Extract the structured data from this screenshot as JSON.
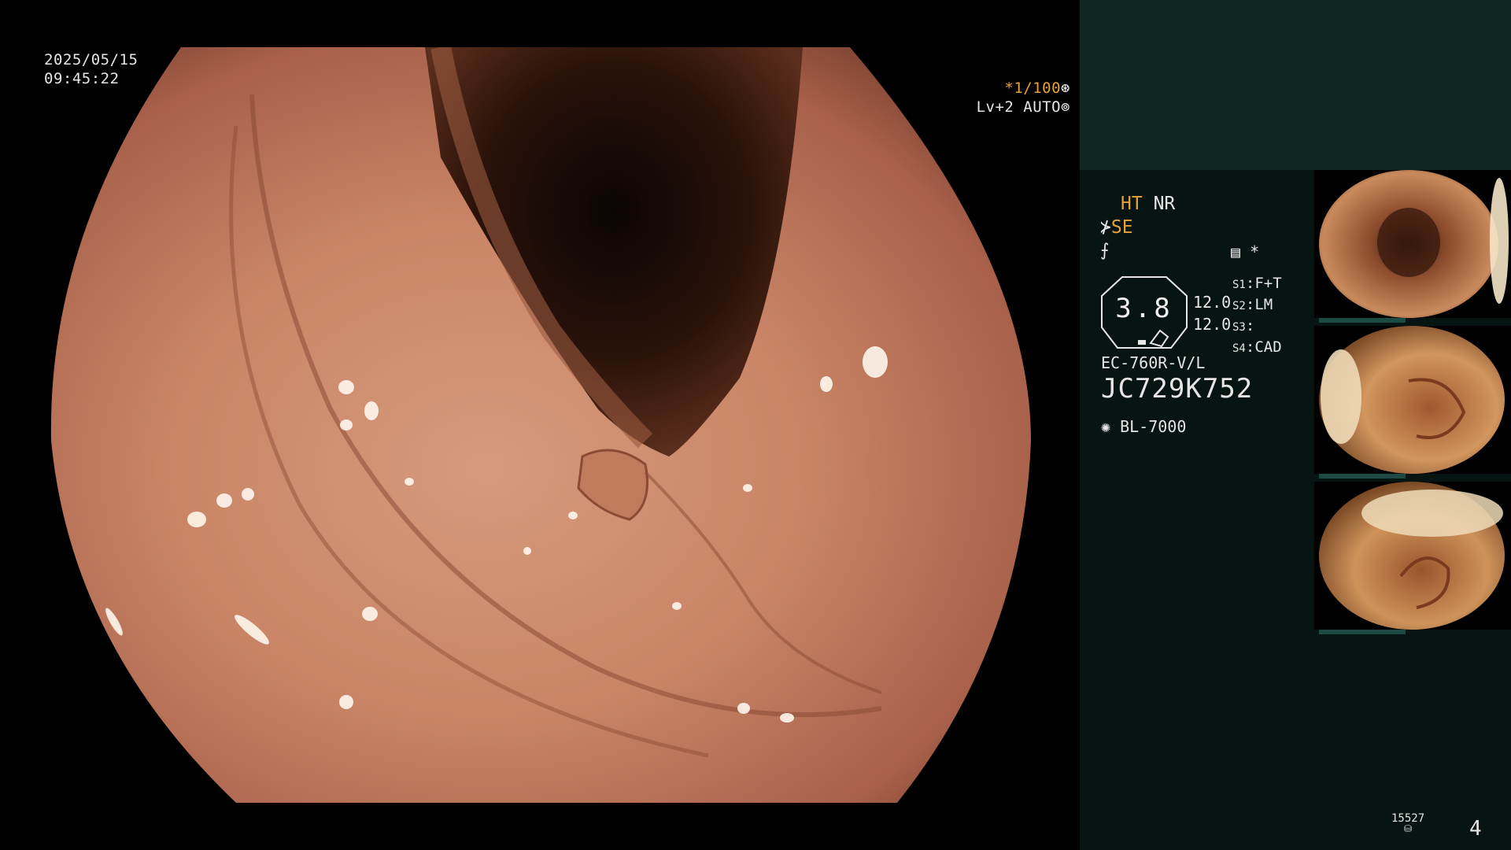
{
  "overlay": {
    "date": "2025/05/15",
    "time": "09:45:22",
    "shutter_speed": "*1/100",
    "level_mode": "Lv+2 AUTO"
  },
  "status_panel": {
    "mode_ht": "HT",
    "mode_nr": "NR",
    "mode_se": "SE",
    "zoom_value": "3.8",
    "iris_top": "12.0",
    "iris_bottom": "12.0",
    "switches": [
      {
        "key": "S1",
        "value": "F+T"
      },
      {
        "key": "S2",
        "value": "LM"
      },
      {
        "key": "S3",
        "value": ""
      },
      {
        "key": "S4",
        "value": "CAD"
      }
    ],
    "menu_marker": "*",
    "scope_model": "EC-760R-V/L",
    "scope_serial": "JC729K752",
    "light_source": "BL-7000"
  },
  "footer": {
    "image_counter": "15527",
    "page_number": "4"
  },
  "colors": {
    "accent_amber": "#e8a23a",
    "panel_dark": "#061512",
    "panel_header": "#0d2723"
  },
  "icons": [
    "aperture-icon",
    "aperture-auto-icon",
    "structure-enhance-icon",
    "color-enhance-icon",
    "menu-list-icon",
    "light-source-icon",
    "storage-icon"
  ]
}
